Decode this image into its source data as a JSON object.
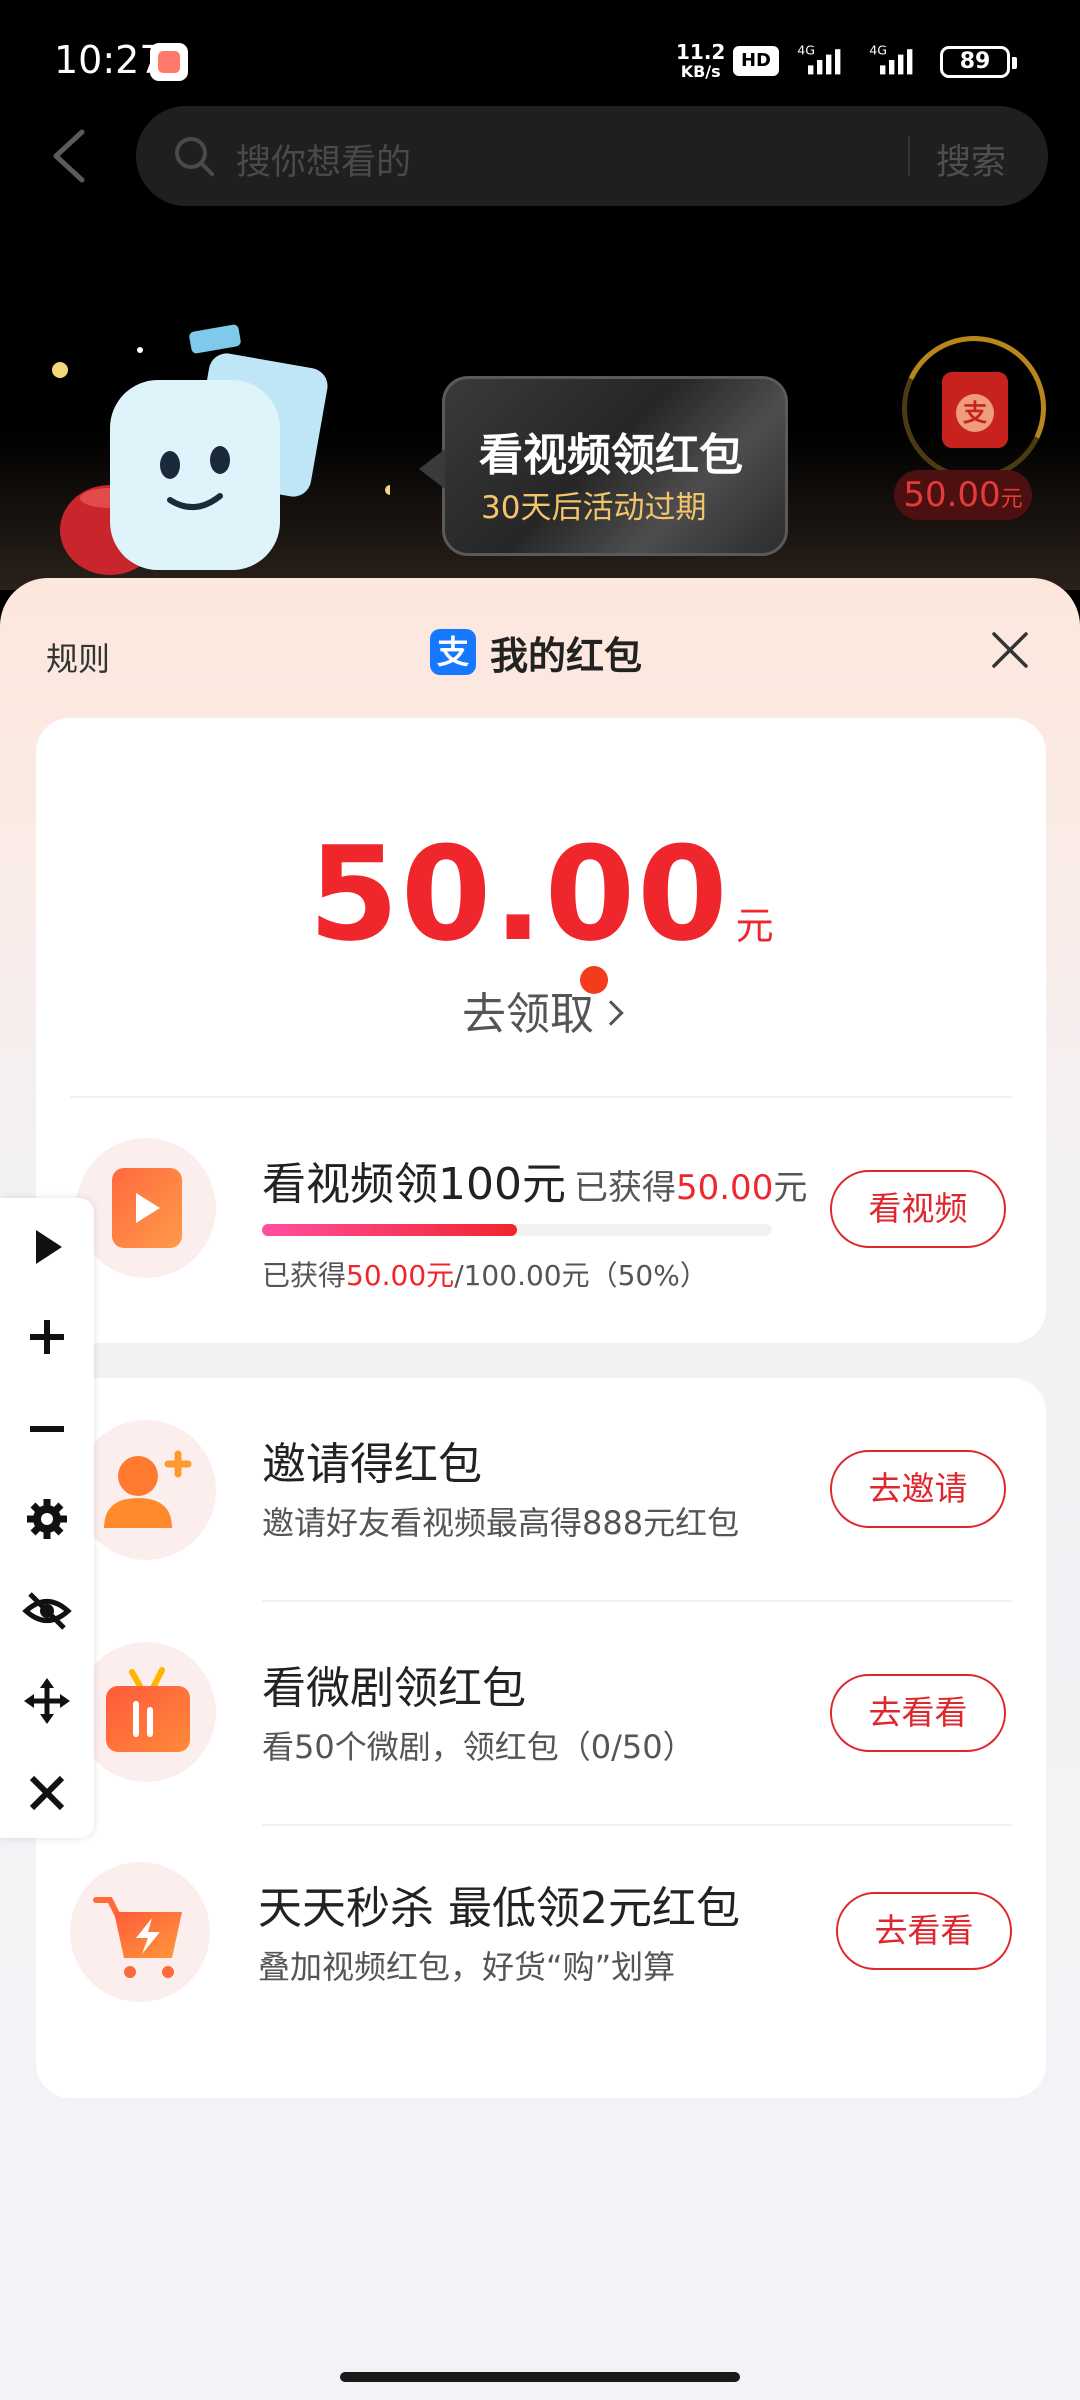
{
  "status_bar": {
    "time": "10:27",
    "net_speed_value": "11.2",
    "net_speed_unit": "KB/s",
    "hd_label": "HD",
    "net_type_1": "4G",
    "net_type_2": "4G",
    "battery": "89"
  },
  "search": {
    "placeholder": "搜你想看的",
    "button": "搜索"
  },
  "promo": {
    "bubble_title": "看视频领红包",
    "bubble_subtitle": "30天后活动过期",
    "widget_amount": "50.00",
    "widget_unit": "元",
    "widget_icon_char": "支"
  },
  "sheet": {
    "rules_label": "规则",
    "title": "我的红包",
    "alipay_icon_char": "支",
    "balance_value": "50.00",
    "balance_unit": "元",
    "claim_label": "去领取",
    "tasks": [
      {
        "title": "看视频领100元",
        "extra_prefix": "已获得",
        "extra_value": "50.00",
        "extra_suffix": "元",
        "sub_prefix": "已获得",
        "sub_value": "50.00元",
        "sub_suffix": "/100.00元（50%）",
        "progress": 0.5,
        "button": "看视频",
        "icon": "play-video-icon"
      },
      {
        "title": "邀请得红包",
        "subtitle": "邀请好友看视频最高得888元红包",
        "button": "去邀请",
        "icon": "invite-user-icon"
      },
      {
        "title": "看微剧领红包",
        "subtitle": "看50个微剧，领红包（0/50）",
        "button": "去看看",
        "icon": "tv-drama-icon"
      },
      {
        "title": "天天秒杀 最低领2元红包",
        "subtitle": "叠加视频红包，好货“购”划算",
        "button": "去看看",
        "icon": "shopping-cart-flash-icon"
      }
    ]
  },
  "colors": {
    "accent_red": "#f0262d",
    "alipay_blue": "#1677ff",
    "gold": "#f3c46a"
  }
}
